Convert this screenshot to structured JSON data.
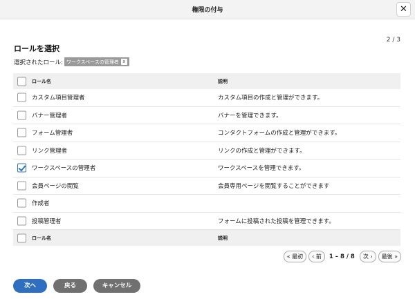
{
  "dialog": {
    "title": "権限の付与",
    "close_label": "✕",
    "step": "2 / 3"
  },
  "section": {
    "title": "ロールを選択",
    "selected_label": "選択されたロール:",
    "selected_tag": "ワークスペースの管理者",
    "selected_tag_remove": "x"
  },
  "table": {
    "header": {
      "name": "ロール名",
      "description": "説明"
    },
    "rows": [
      {
        "name": "カスタム項目管理者",
        "description": "カスタム項目の作成と管理ができます。",
        "checked": false
      },
      {
        "name": "バナー管理者",
        "description": "バナーを管理できます。",
        "checked": false
      },
      {
        "name": "フォーム管理者",
        "description": "コンタクトフォームの作成と管理ができます。",
        "checked": false
      },
      {
        "name": "リンク管理者",
        "description": "リンクの作成と管理ができます。",
        "checked": false
      },
      {
        "name": "ワークスペースの管理者",
        "description": "ワークスペースを管理できます。",
        "checked": true
      },
      {
        "name": "会員ページの閲覧",
        "description": "会員専用ページを閲覧することができます",
        "checked": false
      },
      {
        "name": "作成者",
        "description": "",
        "checked": false
      },
      {
        "name": "投稿管理者",
        "description": "フォームに投稿された投稿を管理できます。",
        "checked": false
      }
    ],
    "footer": {
      "name": "ロール名",
      "description": "説明"
    }
  },
  "pagination": {
    "first": "« 最初",
    "prev": "‹ 前",
    "info": "1 – 8 / 8",
    "next": "次 ›",
    "last": "最後 »"
  },
  "actions": {
    "next": "次へ",
    "back": "戻る",
    "cancel": "キャンセル"
  },
  "colors": {
    "primary": "#2f6fbf",
    "secondary": "#707070",
    "check": "#2f73c8"
  }
}
